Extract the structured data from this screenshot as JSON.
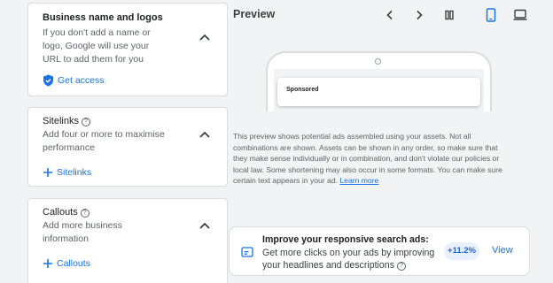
{
  "cards": [
    {
      "title": "Business name and logos",
      "description": "If you don't add a name or logo, Google will use your URL to add them for you",
      "action": "Get access",
      "action_icon": "shield-icon"
    },
    {
      "title": "Sitelinks",
      "description": "Add four or more to maximise performance",
      "action": "Sitelinks",
      "action_icon": "plus-icon"
    },
    {
      "title": "Callouts",
      "description": "Add more business information",
      "action": "Callouts",
      "action_icon": "plus-icon"
    }
  ],
  "preview": {
    "title": "Preview",
    "sponsored": "Sponsored",
    "disclaimer": "This preview shows potential ads assembled using your assets. Not all combinations are shown. Assets can be shown in any order, so make sure that they make sense individually or in combination, and don't violate our policies or local law. Some shortening may also occur in some formats. You can make sure certain text appears in your ad.",
    "learn_more": "Learn more"
  },
  "improve": {
    "bold": "Improve your responsive search ads:",
    "text": " Get more clicks on your ads by improving your headlines and descriptions",
    "badge": "+11.2%",
    "view": "View"
  },
  "colors": {
    "accent": "#1a73e8",
    "badge_bg": "#e8f0fe"
  }
}
